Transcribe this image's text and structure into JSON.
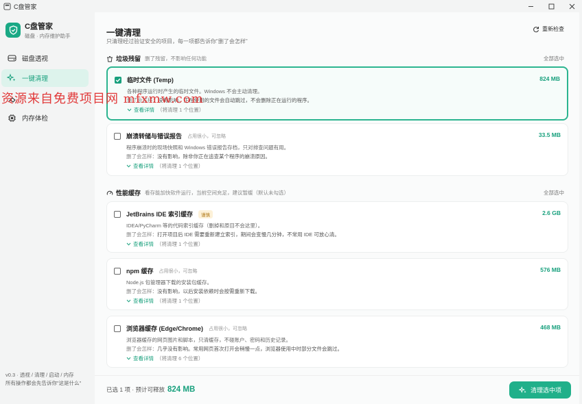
{
  "window": {
    "title": "C盘管家",
    "controls": [
      "minimize",
      "maximize",
      "close"
    ]
  },
  "brand": {
    "name": "C盘管家",
    "subtitle": "磁盘 · 内存维护助手"
  },
  "nav": [
    {
      "label": "磁盘透视",
      "icon": "disk-icon",
      "active": false
    },
    {
      "label": "一键清理",
      "icon": "sparkle-icon",
      "active": true
    },
    {
      "label": "",
      "icon": "broom-icon",
      "active": false
    },
    {
      "label": "内存体检",
      "icon": "chip-icon",
      "active": false
    }
  ],
  "version_note": "v0.3 · 透视 / 清理 / 启动 / 内存\n所有操作都会先告诉你\"这是什么\"",
  "header": {
    "title": "一键清理",
    "description": "只清理经过验证安全的项目，每一项都告诉你\"删了会怎样\"",
    "refresh_label": "重新检查"
  },
  "sections": [
    {
      "title": "垃圾残留",
      "subtitle": "删了残留，不影响任何功能",
      "select_all": "全部选中"
    },
    {
      "title": "性能缓存",
      "subtitle": "看存能加快软件运行，当前空间充足，建议暂缓（默认未勾选）",
      "select_all": "全部选中"
    }
  ],
  "impact_label": "删了会怎样：",
  "detail_label": "查看详情",
  "items": [
    {
      "title": "临时文件 (Temp)",
      "note": "",
      "badge": "",
      "size": "824 MB",
      "checked": true,
      "desc": "各种程序运行时产生的临时文件。Windows 不会主动清理。",
      "impact": "没有影响。正在使用的文件会自动跳过，不会删除正在运行的程序。",
      "detail_count": "（将清理 1 个位置）"
    },
    {
      "title": "崩溃转储与错误报告",
      "note": "占用很小，可忽略",
      "badge": "",
      "size": "33.5 MB",
      "checked": false,
      "desc": "程序崩溃时的现场快照和 Windows 错误报告存档，只对排查问题有用。",
      "impact": "没有影响，除非你正在追查某个程序的崩溃原因。",
      "detail_count": "（将清理 1 个位置）"
    },
    {
      "title": "JetBrains IDE 索引缓存",
      "note": "",
      "badge": "谨慎",
      "size": "2.6 GB",
      "checked": false,
      "desc": "IDEA/PyCharm 等的代码索引缓存（删掉和原目不会这里）。",
      "impact": "打开项目后 IDE 需要重新建立索引，期间会变慢几分钟，不常用 IDE 可放心清。",
      "detail_count": "（将清理 1 个位置）"
    },
    {
      "title": "npm 缓存",
      "note": "占用很小，可忽略",
      "badge": "",
      "size": "576 MB",
      "checked": false,
      "desc": "Node.js 包管理器下载的安装包缓存。",
      "impact": "没有影响，以后安装依赖时会按需重新下载。",
      "detail_count": "（将清理 1 个位置）"
    },
    {
      "title": "浏览器缓存 (Edge/Chrome)",
      "note": "占用很小，可忽略",
      "badge": "",
      "size": "468 MB",
      "checked": false,
      "desc": "浏览器缓存的网页图片和脚本，只清缓存，不碰账户、密码和历史记录。",
      "impact": "几乎没有影响。常用网页首次打开会稍慢一点，浏览器使用中时部分文件会跳过。",
      "detail_count": "（将清理 6 个位置）"
    }
  ],
  "footer": {
    "selected_text": "已选 1 项 · 预计可释放",
    "selected_size": "824 MB",
    "clean_button": "清理选中项"
  },
  "watermark": "资源来自免费项目网 mfxmw.com",
  "colors": {
    "accent": "#18a07d",
    "accent_light": "#ddf3ec",
    "badge_bg": "#fdf1d8",
    "watermark": "#e02a2a"
  }
}
